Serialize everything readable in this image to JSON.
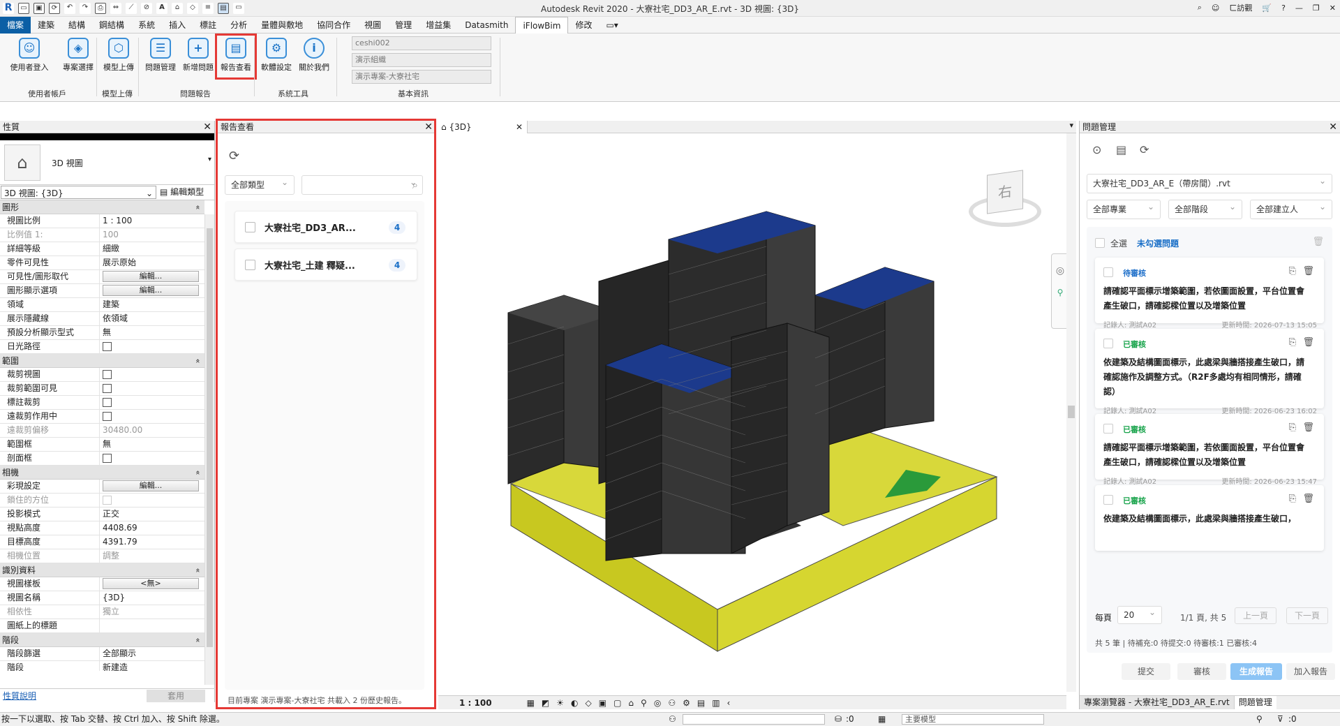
{
  "app_title": "Autodesk Revit 2020 - 大寮社宅_DD3_AR_E.rvt - 3D 視圖: {3D}",
  "user": "ㄈ訪觀",
  "tabs": [
    "檔案",
    "建築",
    "結構",
    "鋼結構",
    "系統",
    "插入",
    "標註",
    "分析",
    "量體與敷地",
    "協同合作",
    "視圖",
    "管理",
    "增益集",
    "Datasmith",
    "iFlowBim",
    "修改"
  ],
  "ribbon": {
    "buttons": [
      "使用者登入",
      "專案選擇",
      "模型上傳",
      "問題管理",
      "新增問題",
      "報告查看",
      "軟體設定",
      "關於我們"
    ],
    "groups": [
      "使用者帳戶",
      "模型上傳",
      "問題報告",
      "系統工具",
      "基本資訊"
    ],
    "info": [
      "ceshi002",
      "演示組織",
      "演示專案-大寮社宅"
    ]
  },
  "properties": {
    "title": "性質",
    "type_name": "3D 視圖",
    "view_selector": "3D 視圖: {3D}",
    "edit_type": "編輯類型",
    "sections": [
      {
        "name": "圖形",
        "rows": [
          {
            "k": "視圖比例",
            "v": "1 : 100",
            "t": "text"
          },
          {
            "k": "比例值 1:",
            "v": "100",
            "t": "dis"
          },
          {
            "k": "詳細等級",
            "v": "細緻",
            "t": "text"
          },
          {
            "k": "零件可見性",
            "v": "展示原始",
            "t": "text"
          },
          {
            "k": "可見性/圖形取代",
            "v": "編輯...",
            "t": "btn"
          },
          {
            "k": "圖形顯示選項",
            "v": "編輯...",
            "t": "btn"
          },
          {
            "k": "領域",
            "v": "建築",
            "t": "text"
          },
          {
            "k": "展示隱藏線",
            "v": "依領域",
            "t": "text"
          },
          {
            "k": "預設分析顯示型式",
            "v": "無",
            "t": "text"
          },
          {
            "k": "日光路徑",
            "v": "",
            "t": "cb"
          }
        ]
      },
      {
        "name": "範圍",
        "rows": [
          {
            "k": "裁剪視圖",
            "v": "",
            "t": "cb"
          },
          {
            "k": "裁剪範圍可見",
            "v": "",
            "t": "cb"
          },
          {
            "k": "標註裁剪",
            "v": "",
            "t": "cb"
          },
          {
            "k": "遠裁剪作用中",
            "v": "",
            "t": "cb"
          },
          {
            "k": "遠裁剪偏移",
            "v": "30480.00",
            "t": "dis"
          },
          {
            "k": "範圍框",
            "v": "無",
            "t": "text"
          },
          {
            "k": "剖面框",
            "v": "",
            "t": "cb"
          }
        ]
      },
      {
        "name": "相機",
        "rows": [
          {
            "k": "彩現設定",
            "v": "編輯...",
            "t": "btn"
          },
          {
            "k": "鎖住的方位",
            "v": "",
            "t": "cbdis"
          },
          {
            "k": "投影模式",
            "v": "正交",
            "t": "text"
          },
          {
            "k": "視點高度",
            "v": "4408.69",
            "t": "text"
          },
          {
            "k": "目標高度",
            "v": "4391.79",
            "t": "text"
          },
          {
            "k": "相機位置",
            "v": "調整",
            "t": "dis"
          }
        ]
      },
      {
        "name": "識別資料",
        "rows": [
          {
            "k": "視圖樣板",
            "v": "<無>",
            "t": "btn"
          },
          {
            "k": "視圖名稱",
            "v": "{3D}",
            "t": "text"
          },
          {
            "k": "相依性",
            "v": "獨立",
            "t": "dis"
          },
          {
            "k": "圖紙上的標題",
            "v": "",
            "t": "text"
          }
        ]
      },
      {
        "name": "階段",
        "rows": [
          {
            "k": "階段篩選",
            "v": "全部顯示",
            "t": "text"
          },
          {
            "k": "階段",
            "v": "新建造",
            "t": "text"
          }
        ]
      }
    ],
    "help_link": "性質說明",
    "apply": "套用"
  },
  "report": {
    "title": "報告查看",
    "filter": "全部類型",
    "items": [
      {
        "name": "大寮社宅_DD3_AR...",
        "count": "4"
      },
      {
        "name": "大寮社宅_土建 釋疑...",
        "count": "4"
      }
    ],
    "footer": "目前專案 演示專案-大寮社宅 共載入 2 份歷史報告。"
  },
  "view": {
    "tab": "{3D}",
    "scale": "1 : 100"
  },
  "issues": {
    "title": "問題管理",
    "file": "大寮社宅_DD3_AR_E（帶房間）.rvt",
    "filters": [
      "全部專業",
      "全部階段",
      "全部建立人"
    ],
    "select_all": "全選",
    "unchecked": "未勾選問題",
    "cards": [
      {
        "status": "待審核",
        "status_color": "#1e6fc9",
        "text": "請確認平面標示增築範圍，若依圖面設置，平台位置會產生破口，請確認樑位置以及增築位置",
        "recorder": "記錄人: 測試A02",
        "time": "更新時間: 2026-07-13 15:05"
      },
      {
        "status": "已審核",
        "status_color": "#17a34a",
        "text": "依建築及結構圖面標示，此處梁與牆搭接產生破口，請確認施作及調整方式。（R2F多處均有相同情形，請確認）",
        "recorder": "記錄人: 測試A02",
        "time": "更新時間: 2026-06-23 16:02"
      },
      {
        "status": "已審核",
        "status_color": "#17a34a",
        "text": "請確認平面標示增築範圍，若依圖面設置，平台位置會產生破口，請確認樑位置以及增築位置",
        "recorder": "記錄人: 測試A02",
        "time": "更新時間: 2026-06-23 15:47"
      },
      {
        "status": "已審核",
        "status_color": "#17a34a",
        "text": "依建築及結構圖面標示，此處梁與牆搭接產生破口，",
        "recorder": "",
        "time": ""
      }
    ],
    "per_page_label": "每頁",
    "per_page": "20",
    "page_info": "1/1 頁, 共 5",
    "prev": "上一頁",
    "next": "下一頁",
    "summary": "共 5 筆 | 待補充:0 待提交:0 待審核:1 已審核:4",
    "actions": [
      "提交",
      "審核",
      "生成報告",
      "加入報告"
    ],
    "bottom_tabs": [
      "專案瀏覽器 - 大寮社宅_DD3_AR_E.rvt",
      "問題管理"
    ]
  },
  "status": {
    "hint": "按一下以選取、按 Tab 交替、按 Ctrl 加入、按 Shift 除選。",
    "zero1": ":0",
    "model": "主要模型",
    "zero2": ":0"
  }
}
